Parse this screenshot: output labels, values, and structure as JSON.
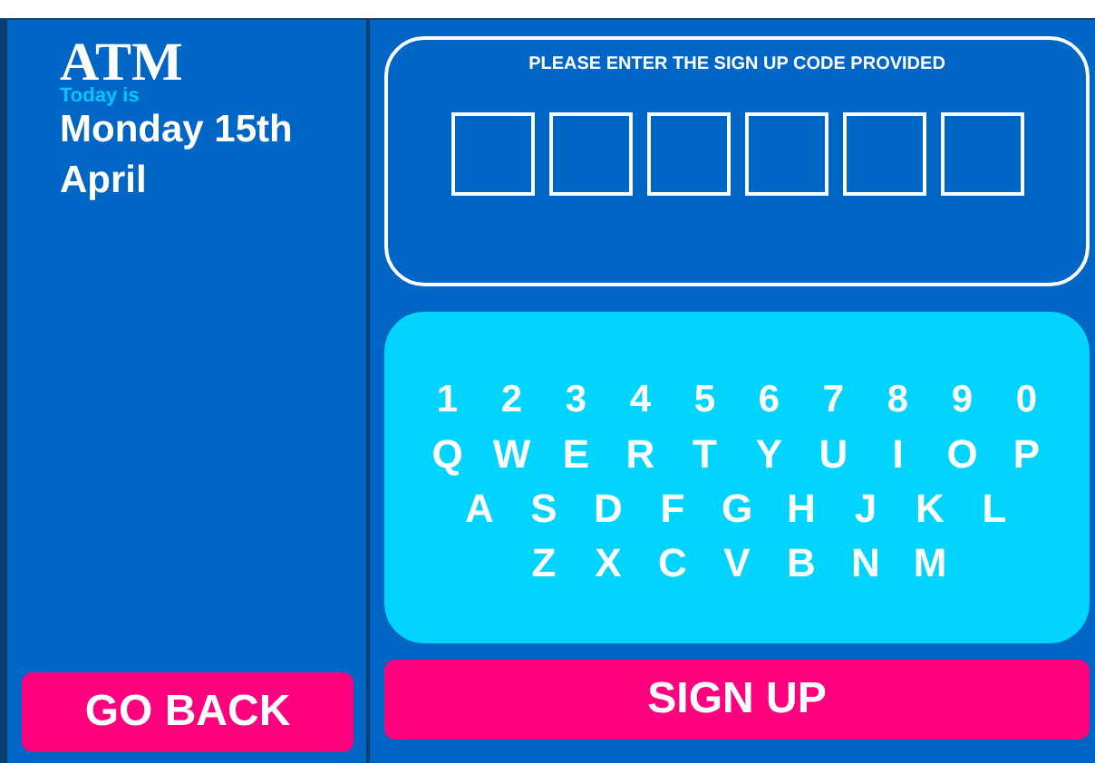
{
  "sidebar": {
    "logo": "ATM",
    "date_caption": "Today is",
    "date": "Monday 15th April",
    "back_button": "GO BACK"
  },
  "code_entry": {
    "prompt": "PLEASE ENTER THE SIGN UP CODE PROVIDED",
    "boxes": [
      {
        "filled": false
      },
      {
        "filled": false
      },
      {
        "filled": false
      },
      {
        "filled": false
      },
      {
        "filled": false
      },
      {
        "filled": false
      }
    ]
  },
  "keyboard": {
    "rows": [
      [
        "1",
        "2",
        "3",
        "4",
        "5",
        "6",
        "7",
        "8",
        "9",
        "0"
      ],
      [
        "Q",
        "W",
        "E",
        "R",
        "T",
        "Y",
        "U",
        "I",
        "O",
        "P"
      ],
      [
        "A",
        "S",
        "D",
        "F",
        "G",
        "H",
        "J",
        "K",
        "L"
      ],
      [
        "Z",
        "X",
        "C",
        "V",
        "B",
        "N",
        "M"
      ]
    ]
  },
  "submit_button": "SIGN UP"
}
